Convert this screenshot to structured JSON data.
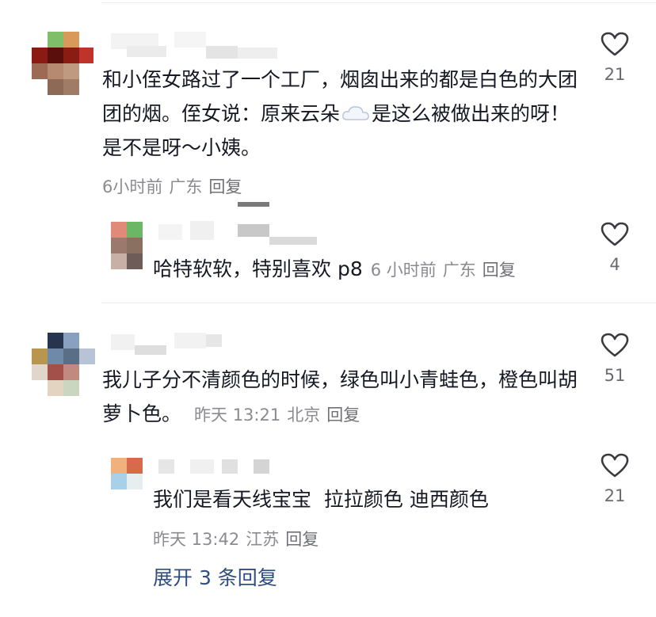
{
  "comments": [
    {
      "text": "和小侄女路过了一个工厂，烟囱出来的都是白色的大团团的烟。侄女说：原来云朵",
      "text_after_icon": "是这么被做出来的呀！是不是呀～小姨。",
      "inline_icon": "cloud-emoji-icon",
      "time": "6小时前",
      "location": "广东",
      "reply_label": "回复",
      "likes": "21"
    },
    {
      "text": "哈特软软，特别喜欢 p8",
      "time": "6 小时前",
      "location": "广东",
      "reply_label": "回复",
      "likes": "4"
    },
    {
      "text": "我儿子分不清颜色的时候，绿色叫小青蛙色，橙色叫胡萝卜色。",
      "time": "昨天 13:21",
      "location": "北京",
      "reply_label": "回复",
      "likes": "51"
    },
    {
      "text": "我们是看天线宝宝  拉拉颜色 迪西颜色",
      "time": "昨天 13:42",
      "location": "江苏",
      "reply_label": "回复",
      "likes": "21"
    }
  ],
  "expand_label": "展开 3 条回复",
  "colors": {
    "text": "#161823",
    "meta": "#8a8b91",
    "link": "#2f4d7e",
    "icon_stroke": "#3a3b40"
  }
}
